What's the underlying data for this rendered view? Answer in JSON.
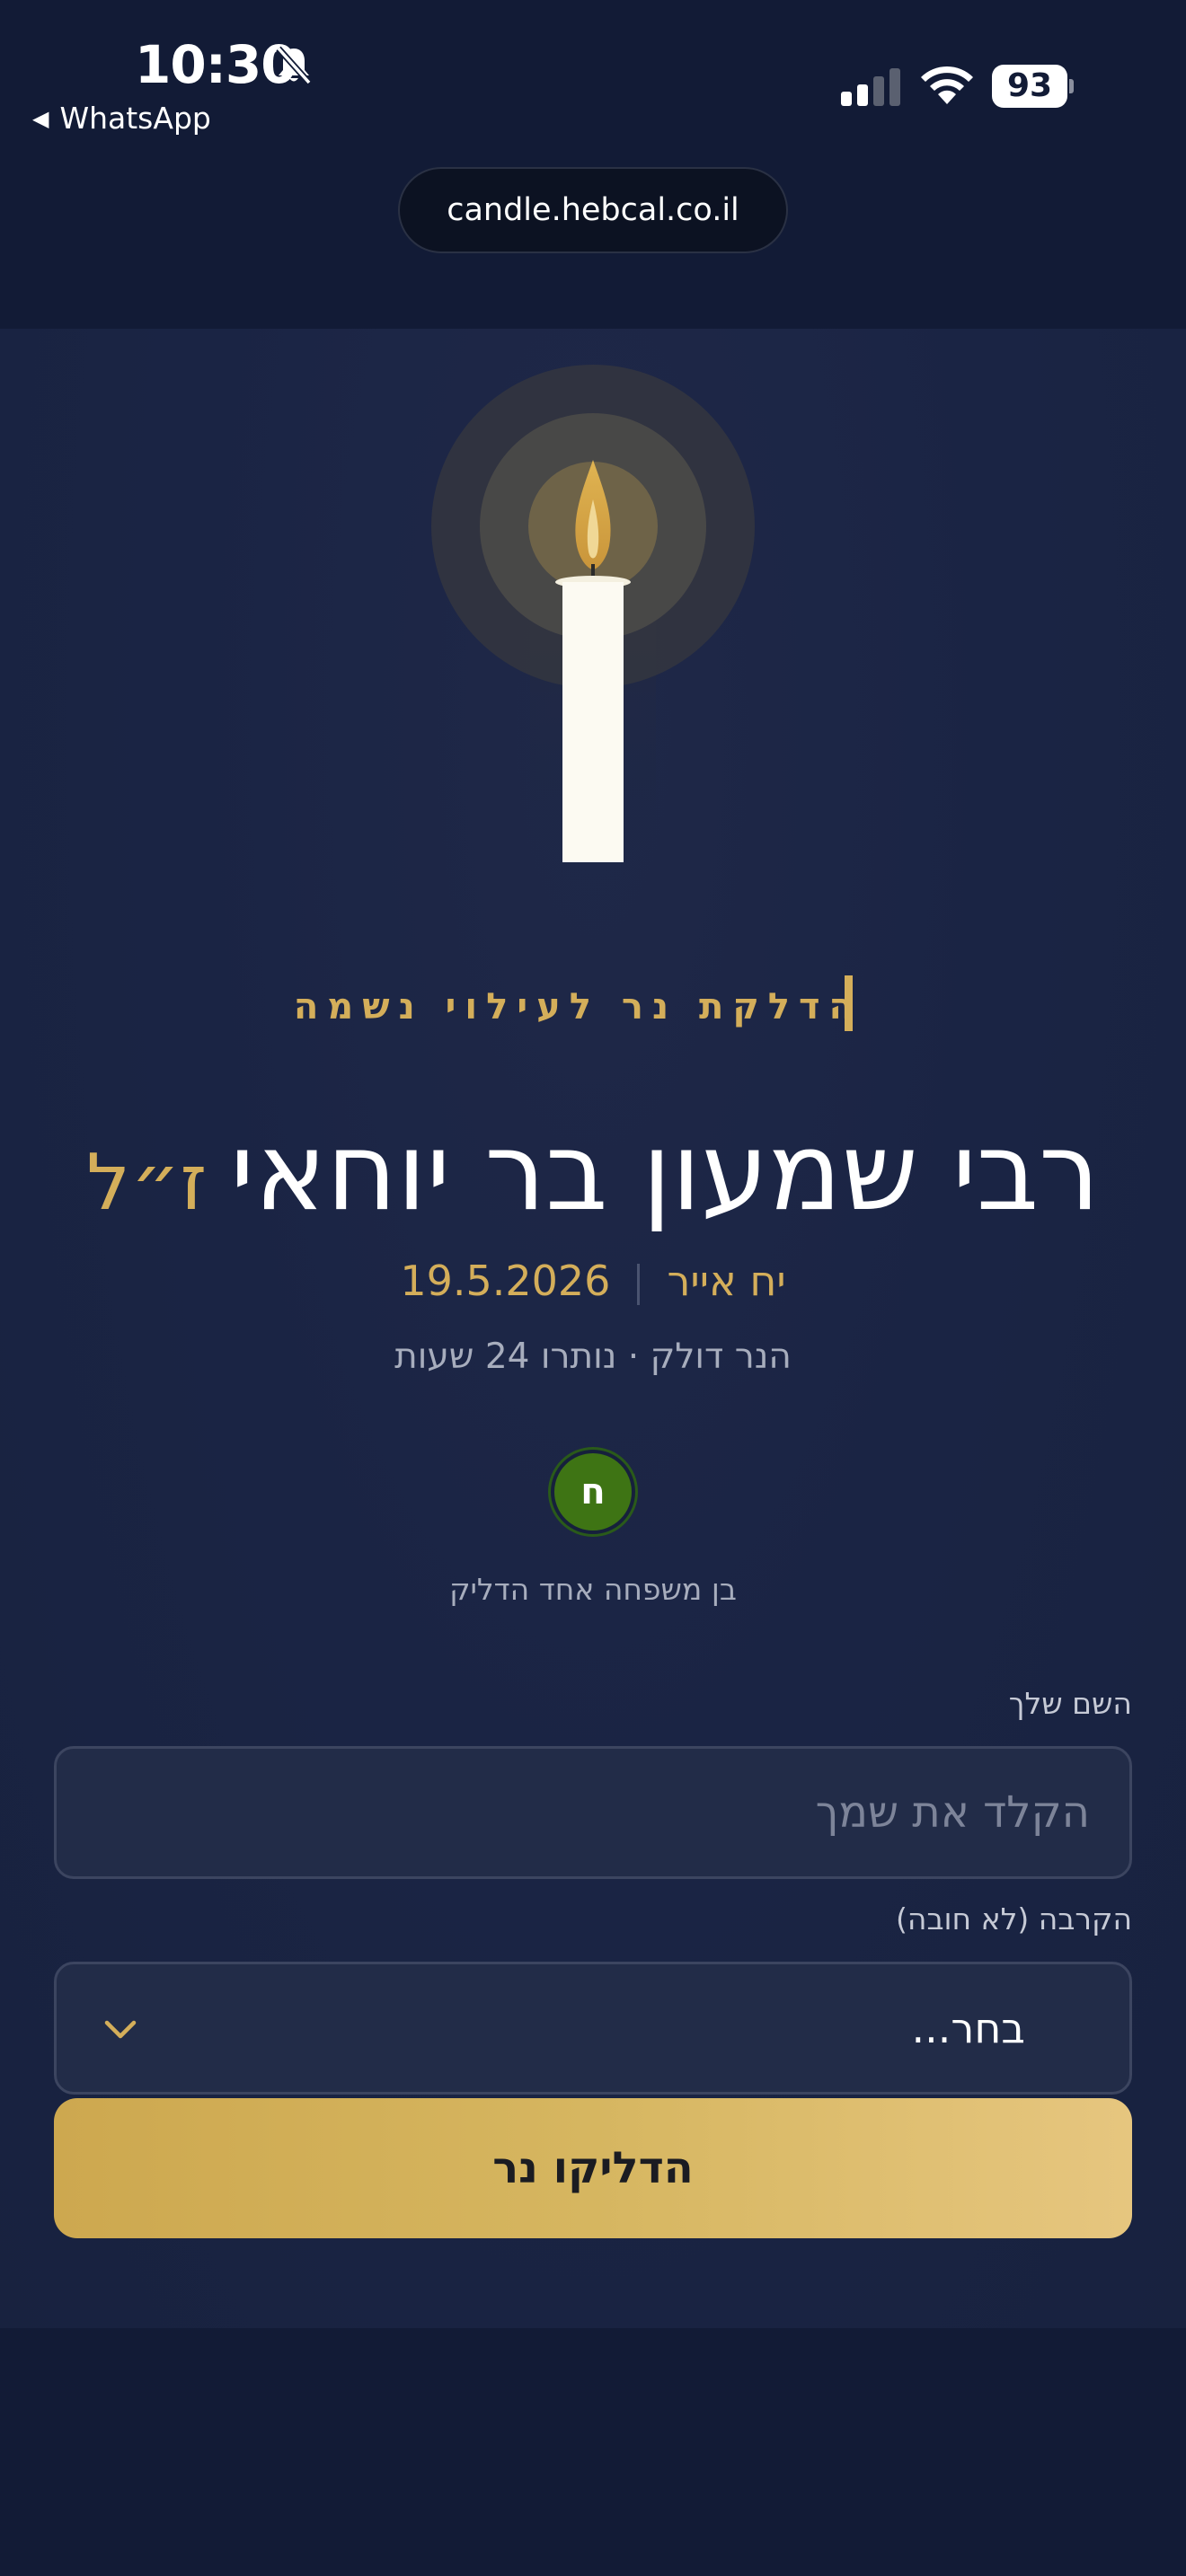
{
  "status_bar": {
    "time": "10:30",
    "back_app": "WhatsApp",
    "battery": "93"
  },
  "browser": {
    "url": "candle.hebcal.co.il"
  },
  "memorial": {
    "kicker": "הדלקת נר לעילוי נשמה",
    "name": "רבי שמעון בר יוחאי",
    "honorific": "ז״ל",
    "hebrew_date": "יח אייר",
    "gregorian_date": "19.5.2026",
    "status": "הנר דולק · נותרו 24 שעות",
    "avatar_initial": "ח",
    "lit_count": "בן משפחה אחד הדליק"
  },
  "form": {
    "name_label": "השם שלך",
    "name_placeholder": "הקלד את שמך",
    "relation_label": "הקרבה (לא חובה)",
    "relation_value": "בחר...",
    "submit_label": "הדליקו נר"
  },
  "colors": {
    "background": "#121b36",
    "accent_gold": "#d4ae5a",
    "avatar_green": "#3e7414"
  }
}
